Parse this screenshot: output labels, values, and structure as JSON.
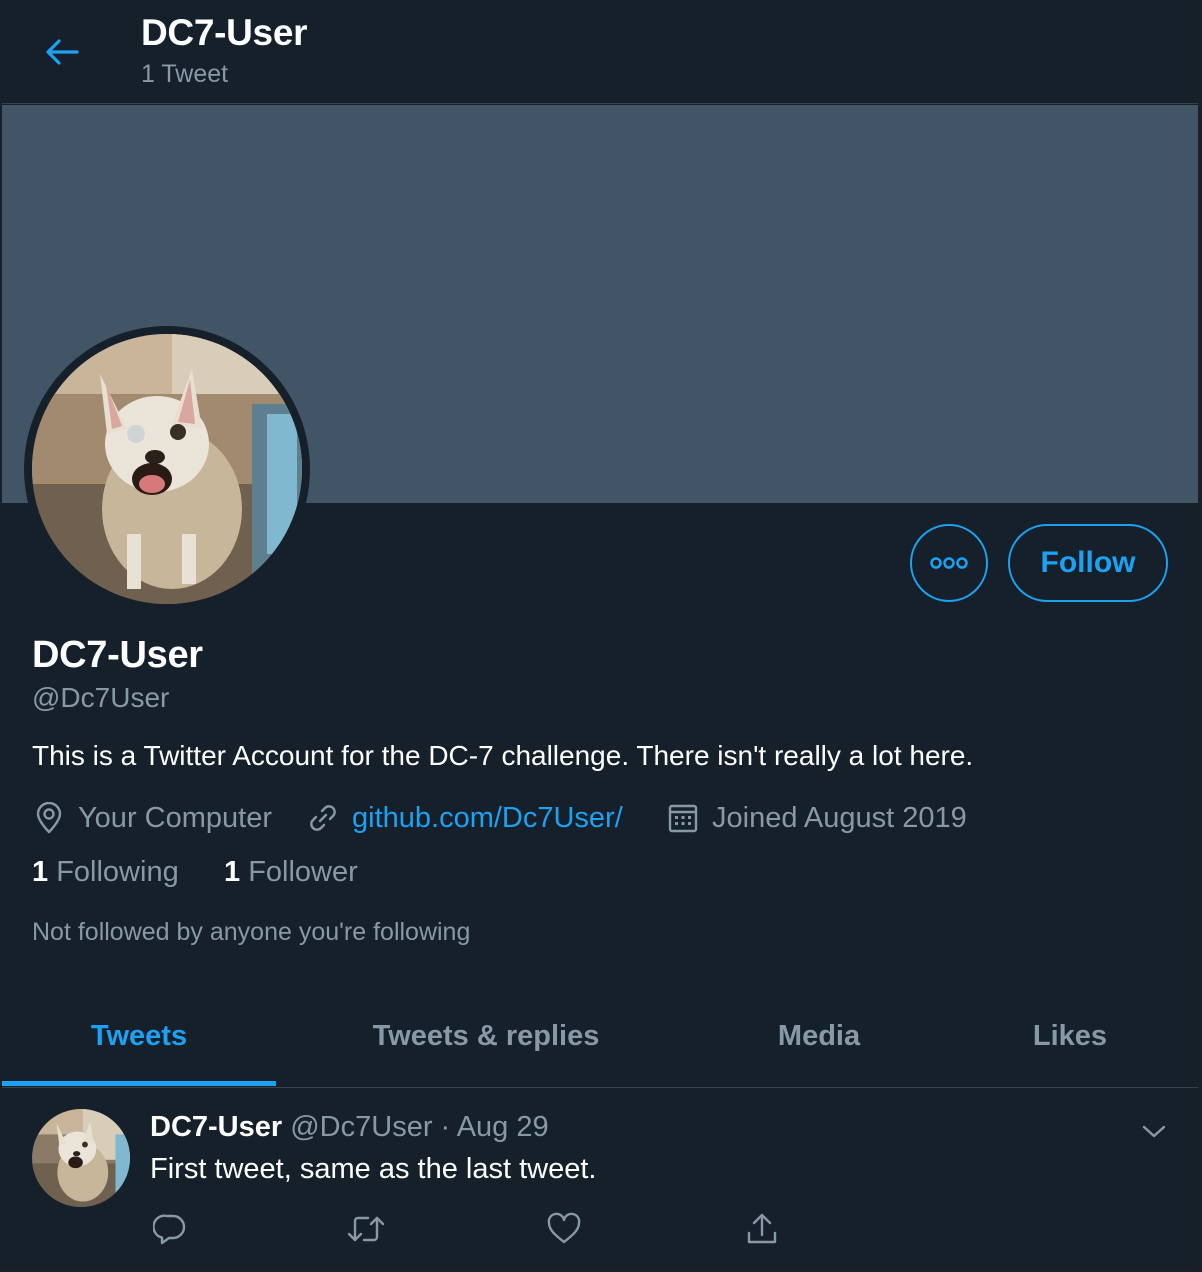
{
  "header": {
    "title": "DC7-User",
    "tweet_count": "1 Tweet"
  },
  "profile": {
    "display_name": "DC7-User",
    "handle": "@Dc7User",
    "bio": "This is a Twitter Account for the DC-7 challenge. There isn't really a lot here.",
    "location": "Your Computer",
    "website": "github.com/Dc7User/",
    "joined": "Joined August 2019",
    "following_count": "1",
    "following_label": "Following",
    "followers_count": "1",
    "followers_label": "Follower",
    "mutuals_note": "Not followed by anyone you're following"
  },
  "actions": {
    "follow_label": "Follow"
  },
  "tabs": [
    {
      "label": "Tweets",
      "active": true
    },
    {
      "label": "Tweets & replies",
      "active": false
    },
    {
      "label": "Media",
      "active": false
    },
    {
      "label": "Likes",
      "active": false
    }
  ],
  "tweet": {
    "author_name": "DC7-User",
    "author_handle": "@Dc7User",
    "separator": "·",
    "date": "Aug 29",
    "text": "First tweet, same as the last tweet."
  },
  "colors": {
    "background": "#15202b",
    "banner": "#425566",
    "accent": "#1da1f2",
    "secondary_text": "#8899a6",
    "divider": "#38444d"
  },
  "icons": {
    "back": "arrow-left-icon",
    "more": "more-dots-icon",
    "location": "location-pin-icon",
    "link": "link-icon",
    "calendar": "calendar-icon",
    "caret": "chevron-down-icon",
    "reply": "reply-icon",
    "retweet": "retweet-icon",
    "like": "heart-icon",
    "share": "share-icon"
  }
}
